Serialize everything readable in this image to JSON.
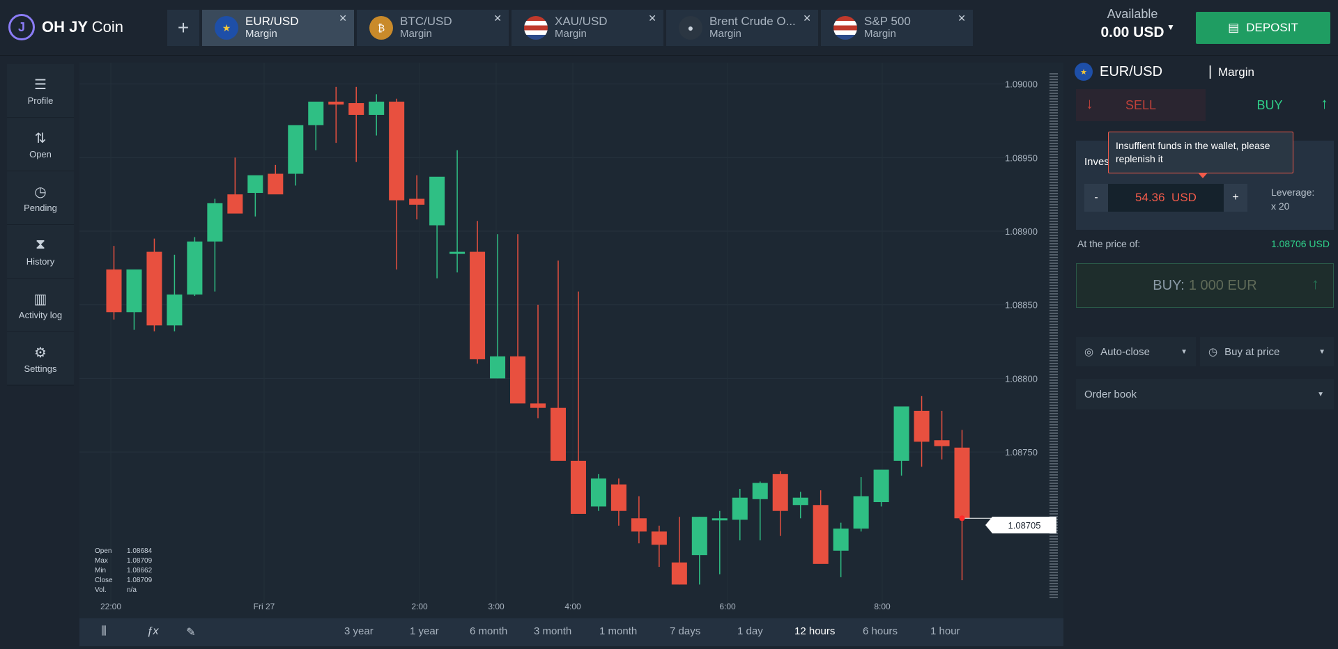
{
  "app": {
    "logo_main": "OH JY",
    "logo_sub": "Coin"
  },
  "tabs": [
    {
      "name": "EUR/USD",
      "sub": "Margin",
      "icon": "eu-flag-icon",
      "color": "#1e4fa8"
    },
    {
      "name": "BTC/USD",
      "sub": "Margin",
      "icon": "bitcoin-icon",
      "color": "#c98a2a"
    },
    {
      "name": "XAU/USD",
      "sub": "Margin",
      "icon": "us-flag-icon",
      "color": "#9aa7c4"
    },
    {
      "name": "Brent Crude O...",
      "sub": "Margin",
      "icon": "oil-drop-icon",
      "color": "#2b3642"
    },
    {
      "name": "S&P 500",
      "sub": "Margin",
      "icon": "us-flag-icon",
      "color": "#9aa7c4"
    }
  ],
  "balance": {
    "label": "Available",
    "value": "0.00 USD"
  },
  "deposit_label": "DEPOSIT",
  "sidebar": [
    {
      "label": "Profile",
      "icon": "menu-icon"
    },
    {
      "label": "Open",
      "icon": "sort-arrows-icon"
    },
    {
      "label": "Pending",
      "icon": "clock-icon"
    },
    {
      "label": "History",
      "icon": "hourglass-icon"
    },
    {
      "label": "Activity log",
      "icon": "book-icon"
    },
    {
      "label": "Settings",
      "icon": "gear-icon"
    }
  ],
  "ohlc": {
    "open_label": "Open",
    "open": "1.08684",
    "max_label": "Max",
    "max": "1.08709",
    "min_label": "Min",
    "min": "1.08662",
    "close_label": "Close",
    "close": "1.08709",
    "vol_label": "Vol.",
    "vol": "n/a"
  },
  "timeframes": [
    "3 year",
    "1 year",
    "6 month",
    "3 month",
    "1 month",
    "7 days",
    "1 day",
    "12 hours",
    "6 hours",
    "1 hour"
  ],
  "active_timeframe": "12 hours",
  "current_price": "1.08705",
  "panel": {
    "pair": "EUR/USD",
    "type": "Margin",
    "sell": "SELL",
    "buy": "BUY",
    "invest_label": "Inves",
    "amount": "54.36",
    "currency": "USD",
    "minus": "-",
    "plus": "+",
    "leverage_label": "Leverage:",
    "leverage_value": "x 20",
    "tooltip": "Insuffient funds in the wallet, please replenish it",
    "price_label": "At the price of:",
    "price_value": "1.08706 USD",
    "buy_big_label": "BUY:",
    "buy_big_amount": "1 000 EUR",
    "auto_close": "Auto-close",
    "buy_at_price": "Buy at price",
    "order_book": "Order book"
  },
  "colors": {
    "up": "#2fbf84",
    "down": "#e8503f",
    "accent": "#1f9d62"
  },
  "chart_data": {
    "type": "candlestick",
    "y_ticks": [
      "1.09000",
      "1.08950",
      "1.08900",
      "1.08850",
      "1.08800",
      "1.08750"
    ],
    "x_ticks": [
      "22:00",
      "Fri 27",
      "2:00",
      "3:00",
      "4:00",
      "6:00",
      "8:00"
    ],
    "ylim": [
      1.08655,
      1.09005
    ],
    "candles": [
      {
        "o": 1.08874,
        "h": 1.0889,
        "l": 1.0884,
        "c": 1.08845
      },
      {
        "o": 1.08845,
        "h": 1.08874,
        "l": 1.08833,
        "c": 1.08874
      },
      {
        "o": 1.08886,
        "h": 1.08895,
        "l": 1.08832,
        "c": 1.08836
      },
      {
        "o": 1.08836,
        "h": 1.08884,
        "l": 1.08832,
        "c": 1.08857
      },
      {
        "o": 1.08857,
        "h": 1.08896,
        "l": 1.08856,
        "c": 1.08893
      },
      {
        "o": 1.08893,
        "h": 1.08922,
        "l": 1.08859,
        "c": 1.08919
      },
      {
        "o": 1.08925,
        "h": 1.0895,
        "l": 1.08915,
        "c": 1.08912
      },
      {
        "o": 1.08926,
        "h": 1.08937,
        "l": 1.0891,
        "c": 1.08938
      },
      {
        "o": 1.08939,
        "h": 1.08945,
        "l": 1.08927,
        "c": 1.08925
      },
      {
        "o": 1.08939,
        "h": 1.08952,
        "l": 1.08931,
        "c": 1.08972
      },
      {
        "o": 1.08972,
        "h": 1.08984,
        "l": 1.08955,
        "c": 1.08988
      },
      {
        "o": 1.08988,
        "h": 1.08998,
        "l": 1.0896,
        "c": 1.08986
      },
      {
        "o": 1.08987,
        "h": 1.08998,
        "l": 1.08947,
        "c": 1.08979
      },
      {
        "o": 1.08979,
        "h": 1.08993,
        "l": 1.08965,
        "c": 1.08988
      },
      {
        "o": 1.08988,
        "h": 1.0899,
        "l": 1.08874,
        "c": 1.08921
      },
      {
        "o": 1.08922,
        "h": 1.08938,
        "l": 1.08908,
        "c": 1.08918
      },
      {
        "o": 1.08904,
        "h": 1.08933,
        "l": 1.08868,
        "c": 1.08937
      },
      {
        "o": 1.08886,
        "h": 1.08955,
        "l": 1.08872,
        "c": 1.08886
      },
      {
        "o": 1.08886,
        "h": 1.08907,
        "l": 1.0881,
        "c": 1.08813
      },
      {
        "o": 1.088,
        "h": 1.08898,
        "l": 1.088,
        "c": 1.08815
      },
      {
        "o": 1.08815,
        "h": 1.08898,
        "l": 1.08796,
        "c": 1.08783
      },
      {
        "o": 1.08783,
        "h": 1.0885,
        "l": 1.08773,
        "c": 1.0878
      },
      {
        "o": 1.0878,
        "h": 1.0888,
        "l": 1.08755,
        "c": 1.08744
      },
      {
        "o": 1.08744,
        "h": 1.08859,
        "l": 1.08728,
        "c": 1.08708
      },
      {
        "o": 1.08713,
        "h": 1.08735,
        "l": 1.0871,
        "c": 1.08732
      },
      {
        "o": 1.08728,
        "h": 1.08732,
        "l": 1.087,
        "c": 1.0871
      },
      {
        "o": 1.08705,
        "h": 1.0872,
        "l": 1.08688,
        "c": 1.08696
      },
      {
        "o": 1.08696,
        "h": 1.087,
        "l": 1.08672,
        "c": 1.08687
      },
      {
        "o": 1.08675,
        "h": 1.08706,
        "l": 1.0866,
        "c": 1.0866
      },
      {
        "o": 1.0868,
        "h": 1.08706,
        "l": 1.0866,
        "c": 1.08706
      },
      {
        "o": 1.08705,
        "h": 1.0871,
        "l": 1.08667,
        "c": 1.08705
      },
      {
        "o": 1.08704,
        "h": 1.08725,
        "l": 1.0869,
        "c": 1.08719
      },
      {
        "o": 1.08718,
        "h": 1.0873,
        "l": 1.0869,
        "c": 1.08729
      },
      {
        "o": 1.08735,
        "h": 1.08737,
        "l": 1.08693,
        "c": 1.0871
      },
      {
        "o": 1.08714,
        "h": 1.08723,
        "l": 1.08705,
        "c": 1.08719
      },
      {
        "o": 1.08714,
        "h": 1.08724,
        "l": 1.08677,
        "c": 1.08674
      },
      {
        "o": 1.08683,
        "h": 1.08702,
        "l": 1.08665,
        "c": 1.08698
      },
      {
        "o": 1.08698,
        "h": 1.08733,
        "l": 1.08696,
        "c": 1.0872
      },
      {
        "o": 1.08716,
        "h": 1.08738,
        "l": 1.08713,
        "c": 1.08738
      },
      {
        "o": 1.08744,
        "h": 1.08766,
        "l": 1.08734,
        "c": 1.08781
      },
      {
        "o": 1.08778,
        "h": 1.08788,
        "l": 1.0874,
        "c": 1.08757
      },
      {
        "o": 1.08758,
        "h": 1.08778,
        "l": 1.08745,
        "c": 1.08754
      },
      {
        "o": 1.08753,
        "h": 1.08765,
        "l": 1.08663,
        "c": 1.08705
      }
    ]
  }
}
